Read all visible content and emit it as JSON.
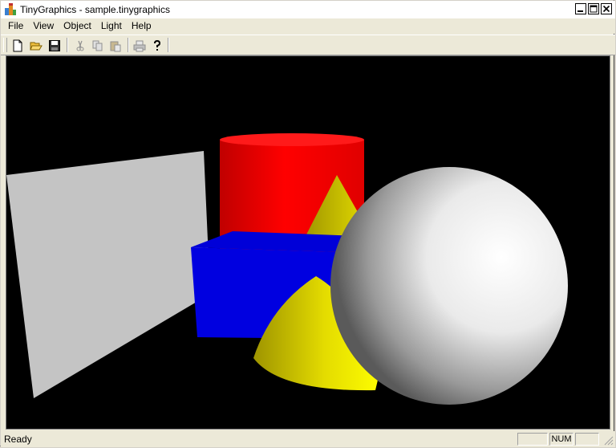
{
  "window": {
    "title": "TinyGraphics - sample.tinygraphics",
    "app_icon": "tinygraphics-app-icon",
    "buttons": [
      "minimize-icon",
      "maximize-icon",
      "close-icon"
    ]
  },
  "menu": {
    "items": [
      {
        "label": "File"
      },
      {
        "label": "View"
      },
      {
        "label": "Object"
      },
      {
        "label": "Light"
      },
      {
        "label": "Help"
      }
    ]
  },
  "toolbar": {
    "buttons": [
      {
        "icon": "new-icon",
        "enabled": true
      },
      {
        "icon": "open-icon",
        "enabled": true
      },
      {
        "icon": "save-icon",
        "enabled": true
      },
      {
        "icon": "cut-icon",
        "enabled": false
      },
      {
        "icon": "copy-icon",
        "enabled": false
      },
      {
        "icon": "paste-icon",
        "enabled": false
      },
      {
        "icon": "print-icon",
        "enabled": false
      },
      {
        "icon": "help-icon",
        "enabled": true
      }
    ]
  },
  "scene": {
    "background": "#000000",
    "objects": [
      {
        "kind": "plane",
        "color": "#c8c8c8"
      },
      {
        "kind": "cylinder",
        "color": "#ff0000"
      },
      {
        "kind": "cone",
        "color": "#ffff00"
      },
      {
        "kind": "cube",
        "color": "#0000ff"
      },
      {
        "kind": "cone",
        "color": "#ffff00"
      },
      {
        "kind": "sphere",
        "color": "#ffffff"
      }
    ]
  },
  "status": {
    "text": "Ready",
    "panes": [
      "",
      "NUM",
      ""
    ]
  }
}
